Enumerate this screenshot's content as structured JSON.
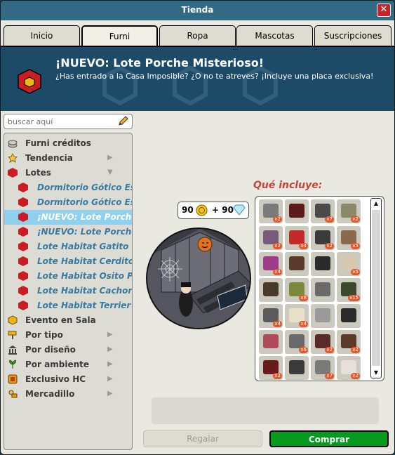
{
  "window": {
    "title": "Tienda"
  },
  "tabs": [
    {
      "label": "Inicio",
      "active": false
    },
    {
      "label": "Furni",
      "active": true
    },
    {
      "label": "Ropa",
      "active": false
    },
    {
      "label": "Mascotas",
      "active": false
    },
    {
      "label": "Suscripciones",
      "active": false
    }
  ],
  "banner": {
    "title": "¡NUEVO: Lote Porche Misterioso!",
    "subtitle": "¿Has entrado a la Casa Imposible? ¿O no te atreves? ¡Incluye una placa exclusiva!"
  },
  "search": {
    "placeholder": "buscar aquí"
  },
  "tree": {
    "items": [
      {
        "label": "Furni créditos",
        "icon": "coins-stack-icon"
      },
      {
        "label": "Tendencia",
        "icon": "star-icon"
      },
      {
        "label": "Lotes",
        "icon": "bundle-cube-icon"
      },
      {
        "label": "Dormitorio Gótico Espeluznante",
        "icon": "bundle-cube-icon"
      },
      {
        "label": "Dormitorio Gótico Espeluznante",
        "icon": "bundle-cube-icon"
      },
      {
        "label": "¡NUEVO: Lote Porche Misterioso!",
        "icon": "bundle-cube-icon"
      },
      {
        "label": "¡NUEVO: Lote Porche Misterioso!",
        "icon": "bundle-cube-icon"
      },
      {
        "label": "Lote Habitat Gatito",
        "icon": "bundle-cube-icon"
      },
      {
        "label": "Lote Habitat Cerdito",
        "icon": "bundle-cube-icon"
      },
      {
        "label": "Lote Habitat Osito Polar",
        "icon": "bundle-cube-icon"
      },
      {
        "label": "Lote Habitat Cachorro",
        "icon": "bundle-cube-icon"
      },
      {
        "label": "Lote Habitat Terrier",
        "icon": "bundle-cube-icon"
      },
      {
        "label": "Evento en Sala",
        "icon": "gold-cube-icon"
      },
      {
        "label": "Por tipo",
        "icon": "paint-roller-icon"
      },
      {
        "label": "Por diseño",
        "icon": "columns-icon"
      },
      {
        "label": "Por ambiente",
        "icon": "plant-icon"
      },
      {
        "label": "Exclusivo HC",
        "icon": "hc-badge-icon"
      },
      {
        "label": "Mercadillo",
        "icon": "trader-icon"
      }
    ]
  },
  "includes": {
    "title": "Qué incluye:",
    "price": {
      "credits": "90",
      "plus": "+ 90"
    },
    "quantities": [
      "x2",
      "x7",
      "x2",
      "x2",
      "x4",
      "x2",
      "x5",
      "x4",
      "x5",
      "x8",
      "x15",
      "x4",
      "x4",
      "x6",
      "x2",
      "x2",
      "x2",
      "x7",
      "x2"
    ]
  },
  "buttons": {
    "gift": "Regalar",
    "buy": "Comprar"
  },
  "colors": {
    "titlebar": "#306a85",
    "banner": "#1c4a67",
    "buy": "#069b1f",
    "selected_row": "#8fd0ec",
    "includes_title": "#c6433e"
  }
}
